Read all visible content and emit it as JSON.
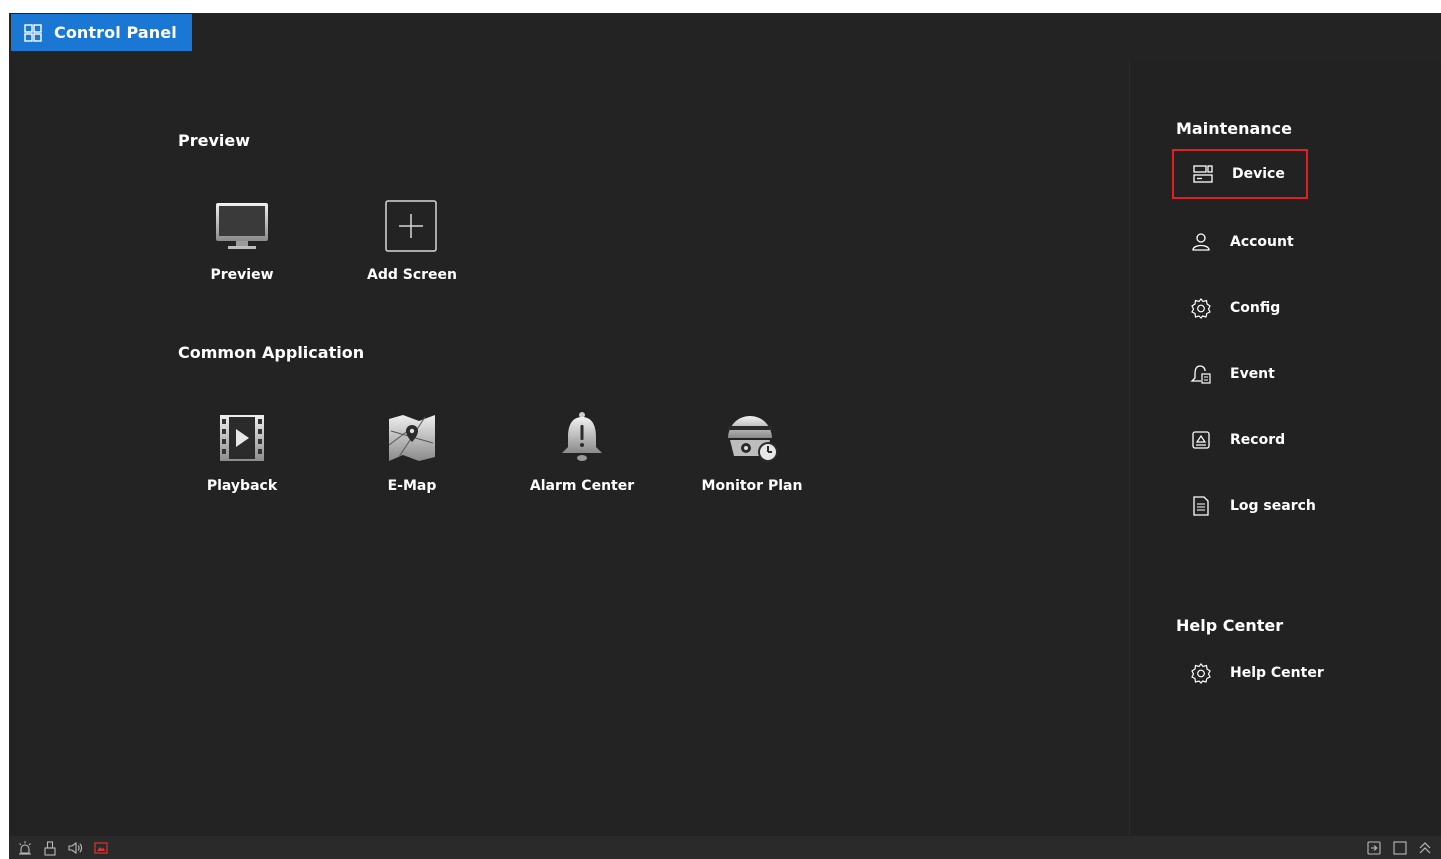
{
  "tab": {
    "label": "Control Panel",
    "icon": "grid-icon",
    "color": "#1a78d4"
  },
  "preview_section": {
    "title": "Preview",
    "items": [
      {
        "label": "Preview",
        "icon": "monitor-icon"
      },
      {
        "label": "Add Screen",
        "icon": "plus-box-icon"
      }
    ]
  },
  "common_section": {
    "title": "Common Application",
    "items": [
      {
        "label": "Playback",
        "icon": "film-play-icon"
      },
      {
        "label": "E-Map",
        "icon": "map-icon"
      },
      {
        "label": "Alarm Center",
        "icon": "bell-icon"
      },
      {
        "label": "Monitor Plan",
        "icon": "dome-camera-clock-icon"
      }
    ]
  },
  "maintenance": {
    "title": "Maintenance",
    "items": [
      {
        "label": "Device",
        "icon": "device-icon",
        "selected": true
      },
      {
        "label": "Account",
        "icon": "user-icon"
      },
      {
        "label": "Config",
        "icon": "gear-icon"
      },
      {
        "label": "Event",
        "icon": "event-bell-icon"
      },
      {
        "label": "Record",
        "icon": "record-icon"
      },
      {
        "label": "Log search",
        "icon": "document-icon"
      }
    ]
  },
  "help_center": {
    "title": "Help Center",
    "items": [
      {
        "label": "Help Center",
        "icon": "gear-icon"
      }
    ]
  },
  "statusbar": {
    "left_icons": [
      "alarm-light-icon",
      "usb-icon",
      "speaker-icon",
      "alert-image-icon"
    ],
    "right_icons": [
      "exit-icon",
      "maximize-icon",
      "collapse-up-icon"
    ]
  },
  "colors": {
    "background": "#232323",
    "accent": "#1a78d4",
    "selection": "#e02020"
  }
}
